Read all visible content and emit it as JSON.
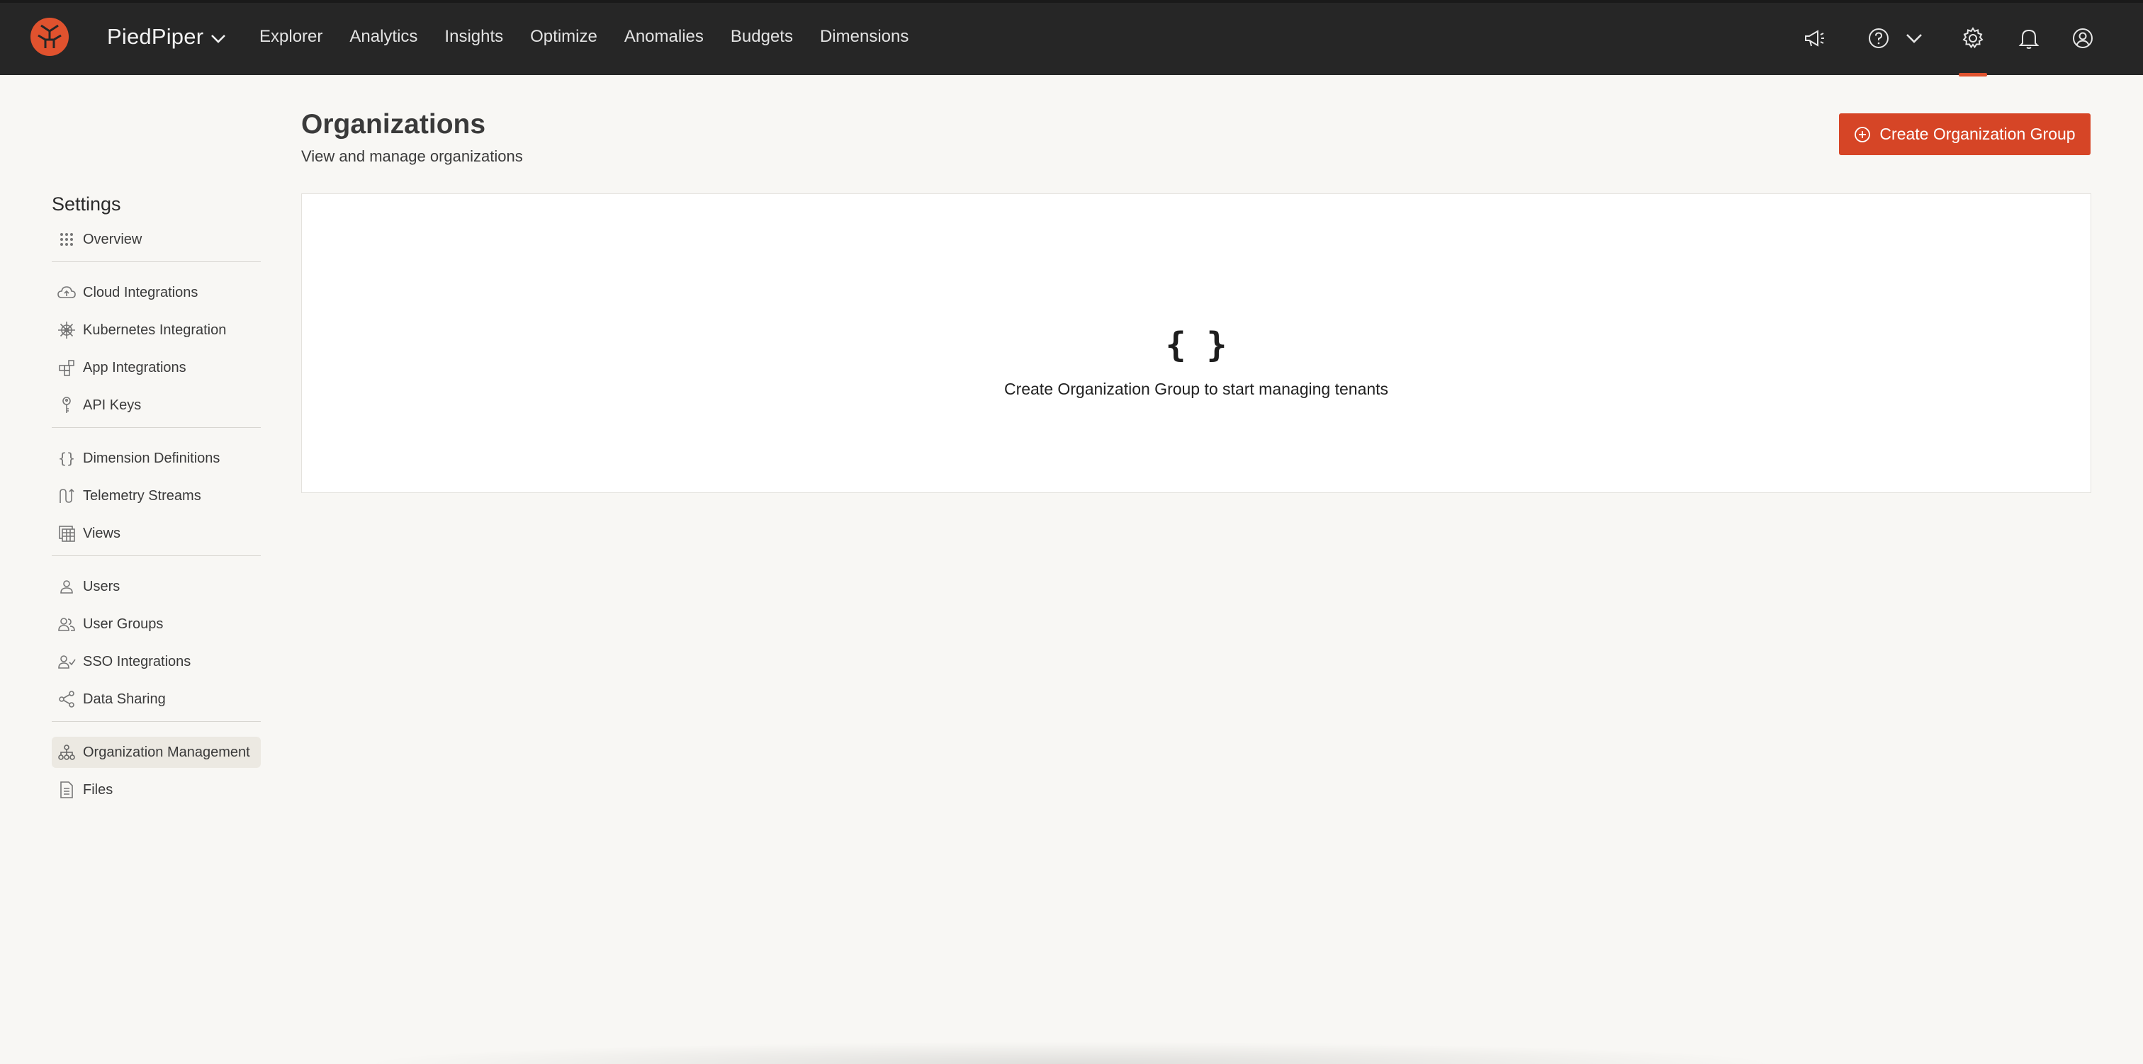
{
  "header": {
    "brand": "PiedPiper",
    "nav": [
      "Explorer",
      "Analytics",
      "Insights",
      "Optimize",
      "Anomalies",
      "Budgets",
      "Dimensions"
    ],
    "accent_color": "#e0522e",
    "icons": [
      "megaphone-icon",
      "help-icon",
      "chevron-down-icon",
      "gear-icon",
      "bell-icon",
      "user-circle-icon"
    ]
  },
  "sidebar": {
    "title": "Settings",
    "groups": [
      [
        {
          "label": "Overview",
          "icon": "grid-icon"
        }
      ],
      [
        {
          "label": "Cloud Integrations",
          "icon": "cloud-icon"
        },
        {
          "label": "Kubernetes Integration",
          "icon": "helm-icon"
        },
        {
          "label": "App Integrations",
          "icon": "blocks-icon"
        },
        {
          "label": "API Keys",
          "icon": "key-icon"
        }
      ],
      [
        {
          "label": "Dimension Definitions",
          "icon": "braces-icon"
        },
        {
          "label": "Telemetry Streams",
          "icon": "stream-icon"
        },
        {
          "label": "Views",
          "icon": "table-icon"
        }
      ],
      [
        {
          "label": "Users",
          "icon": "user-icon"
        },
        {
          "label": "User Groups",
          "icon": "users-icon"
        },
        {
          "label": "SSO Integrations",
          "icon": "user-check-icon"
        },
        {
          "label": "Data Sharing",
          "icon": "share-icon"
        }
      ],
      [
        {
          "label": "Organization Management",
          "icon": "org-icon",
          "active": true
        },
        {
          "label": "Files",
          "icon": "file-icon"
        }
      ]
    ]
  },
  "main": {
    "title": "Organizations",
    "subtitle": "View and manage organizations",
    "create_button": "Create Organization Group",
    "empty_icon": "{ }",
    "empty_text": "Create Organization Group to start managing tenants",
    "button_color": "#d64526"
  }
}
